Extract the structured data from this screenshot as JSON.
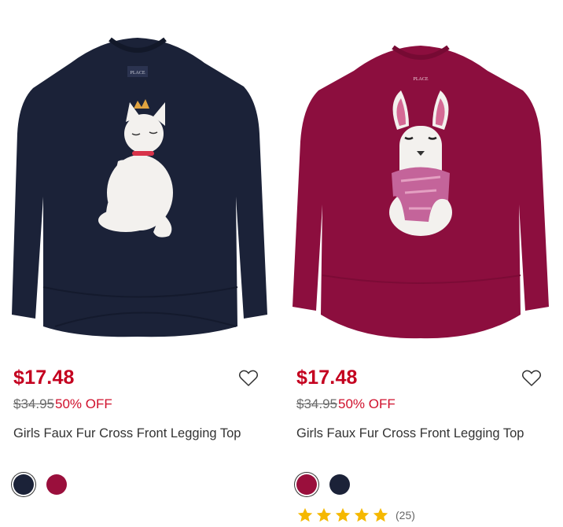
{
  "products": [
    {
      "sale_price": "$17.48",
      "was_price": "$34.95",
      "discount": "50% OFF",
      "title": "Girls Faux Fur Cross Front Legging Top",
      "image_alt": "Navy long sleeve top with faux fur cat",
      "brand_tag": "PLACE",
      "shirt_color": "#1b2238",
      "swatches": [
        {
          "name": "navy",
          "color": "#1b2238",
          "selected": true
        },
        {
          "name": "burgundy",
          "color": "#9a0f3c",
          "selected": false
        }
      ]
    },
    {
      "sale_price": "$17.48",
      "was_price": "$34.95",
      "discount": "50% OFF",
      "title": "Girls Faux Fur Cross Front Legging Top",
      "image_alt": "Burgundy long sleeve top with faux fur llama",
      "brand_tag": "PLACE",
      "shirt_color": "#8c0e3e",
      "swatches": [
        {
          "name": "burgundy",
          "color": "#9a0f3c",
          "selected": true
        },
        {
          "name": "navy",
          "color": "#1b2238",
          "selected": false
        }
      ],
      "rating": 5,
      "review_count": "(25)"
    }
  ],
  "colors": {
    "price_red": "#c4001f",
    "star_gold": "#f5b800"
  },
  "icons": {
    "favorite": "heart-outline-icon",
    "star": "star-icon"
  }
}
